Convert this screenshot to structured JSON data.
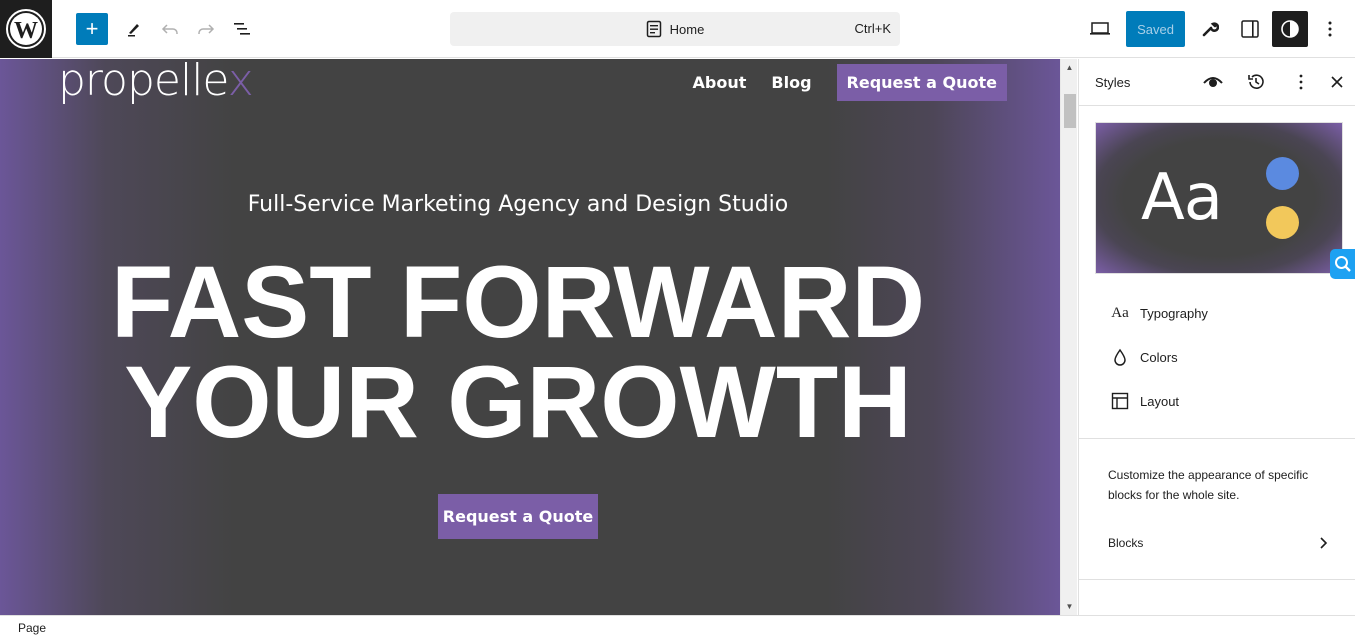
{
  "toolbar": {
    "add_label": "+",
    "icons": [
      "wordpress-logo",
      "add-block",
      "edit-tools",
      "undo",
      "redo",
      "document-overview"
    ],
    "command_bar": {
      "page_title": "Home",
      "shortcut": "Ctrl+K"
    },
    "saved_label": "Saved",
    "right_icons": [
      "device-preview",
      "wrench",
      "settings-sidebar",
      "styles",
      "options"
    ]
  },
  "canvas": {
    "logo_text": "propelle",
    "logo_x": "x",
    "nav": [
      {
        "label": "About"
      },
      {
        "label": "Blog"
      }
    ],
    "nav_cta": "Request a Quote",
    "tagline": "Full-Service Marketing Agency and Design Studio",
    "headline_line1": "FAST FORWARD",
    "headline_line2": "YOUR GROWTH",
    "cta": "Request a Quote",
    "colors": {
      "accent": "#7b5ea7",
      "background": "#434343"
    }
  },
  "sidebar": {
    "title": "Styles",
    "preview": {
      "sample_text": "Aa",
      "color_1": "#5b8ae0",
      "color_2": "#f2c85b"
    },
    "items": [
      {
        "label": "Typography",
        "icon": "typography"
      },
      {
        "label": "Colors",
        "icon": "color-drop"
      },
      {
        "label": "Layout",
        "icon": "layout"
      }
    ],
    "description": "Customize the appearance of specific blocks for the whole site.",
    "blocks_label": "Blocks"
  },
  "footer": {
    "breadcrumb": "Page"
  }
}
